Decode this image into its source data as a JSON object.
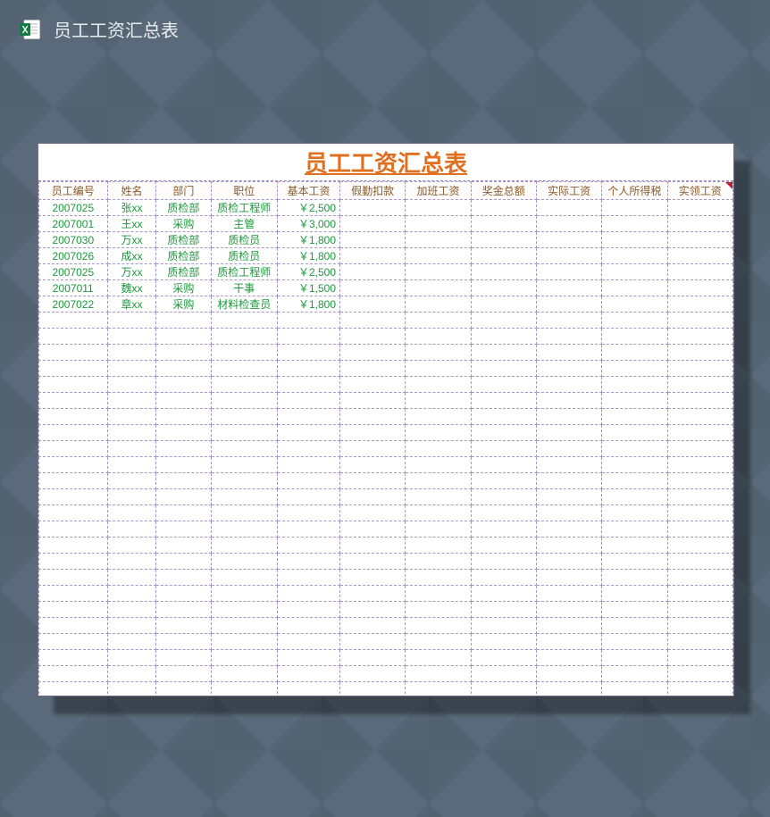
{
  "app": {
    "title": "员工工资汇总表"
  },
  "sheet": {
    "title": "员工工资汇总表",
    "headers": [
      "员工编号",
      "姓名",
      "部门",
      "职位",
      "基本工资",
      "假勤扣款",
      "加班工资",
      "奖金总额",
      "实际工资",
      "个人所得税",
      "实领工资"
    ],
    "rows": [
      {
        "id": "2007025",
        "name": "张xx",
        "dept": "质检部",
        "pos": "质检工程师",
        "base": "￥2,500"
      },
      {
        "id": "2007001",
        "name": "王xx",
        "dept": "采购",
        "pos": "主管",
        "base": "￥3,000"
      },
      {
        "id": "2007030",
        "name": "万xx",
        "dept": "质检部",
        "pos": "质检员",
        "base": "￥1,800"
      },
      {
        "id": "2007026",
        "name": "成xx",
        "dept": "质检部",
        "pos": "质检员",
        "base": "￥1,800"
      },
      {
        "id": "2007025",
        "name": "万xx",
        "dept": "质检部",
        "pos": "质检工程师",
        "base": "￥2,500"
      },
      {
        "id": "2007011",
        "name": "魏xx",
        "dept": "采购",
        "pos": "干事",
        "base": "￥1,500"
      },
      {
        "id": "2007022",
        "name": "章xx",
        "dept": "采购",
        "pos": "材料检查员",
        "base": "￥1,800"
      }
    ]
  },
  "chart_data": {
    "type": "table",
    "title": "员工工资汇总表",
    "columns": [
      "员工编号",
      "姓名",
      "部门",
      "职位",
      "基本工资",
      "假勤扣款",
      "加班工资",
      "奖金总额",
      "实际工资",
      "个人所得税",
      "实领工资"
    ],
    "data": [
      [
        "2007025",
        "张xx",
        "质检部",
        "质检工程师",
        2500,
        null,
        null,
        null,
        null,
        null,
        null
      ],
      [
        "2007001",
        "王xx",
        "采购",
        "主管",
        3000,
        null,
        null,
        null,
        null,
        null,
        null
      ],
      [
        "2007030",
        "万xx",
        "质检部",
        "质检员",
        1800,
        null,
        null,
        null,
        null,
        null,
        null
      ],
      [
        "2007026",
        "成xx",
        "质检部",
        "质检员",
        1800,
        null,
        null,
        null,
        null,
        null,
        null
      ],
      [
        "2007025",
        "万xx",
        "质检部",
        "质检工程师",
        2500,
        null,
        null,
        null,
        null,
        null,
        null
      ],
      [
        "2007011",
        "魏xx",
        "采购",
        "干事",
        1500,
        null,
        null,
        null,
        null,
        null,
        null
      ],
      [
        "2007022",
        "章xx",
        "采购",
        "材料检查员",
        1800,
        null,
        null,
        null,
        null,
        null,
        null
      ]
    ]
  }
}
